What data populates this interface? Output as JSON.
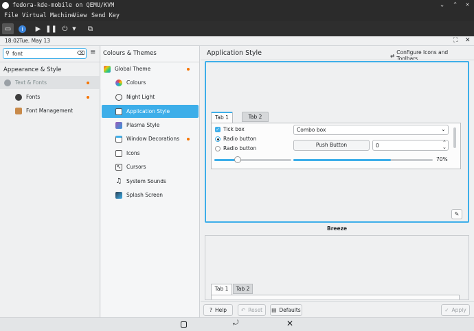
{
  "window": {
    "title": "fedora-kde-mobile on QEMU/KVM"
  },
  "menu": [
    "File",
    "Virtual Machine",
    "View",
    "Send Key"
  ],
  "vm_top": {
    "time": "18:02",
    "date": "Tue. May 13"
  },
  "search": {
    "value": "font"
  },
  "left": {
    "heading": "Appearance & Style",
    "items": [
      "Text & Fonts",
      "Fonts",
      "Font Management"
    ]
  },
  "mid": {
    "heading": "Colours & Themes",
    "items": [
      "Global Theme",
      "Colours",
      "Night Light",
      "Application Style",
      "Plasma Style",
      "Window Decorations",
      "Icons",
      "Cursors",
      "System Sounds",
      "Splash Screen"
    ]
  },
  "right": {
    "heading": "Application Style",
    "configure_label": "Configure Icons and Toolbars...",
    "preview": {
      "tab1": "Tab 1",
      "tab2": "Tab 2",
      "checkbox": "Tick box",
      "radio1": "Radio button",
      "radio2": "Radio button",
      "combo": "Combo box",
      "push": "Push Button",
      "spin": "0",
      "progress_text": "70%",
      "progress": 0.7,
      "slider": 0.3
    },
    "style_name": "Breeze",
    "preview2": {
      "tab1": "Tab 1",
      "tab2": "Tab 2"
    }
  },
  "buttons": {
    "help": "Help",
    "reset": "Reset",
    "defaults": "Defaults",
    "apply": "Apply"
  },
  "colors": {
    "accent": "#3daee9",
    "dark": "#2b2b2b",
    "badge": "#f67400"
  }
}
